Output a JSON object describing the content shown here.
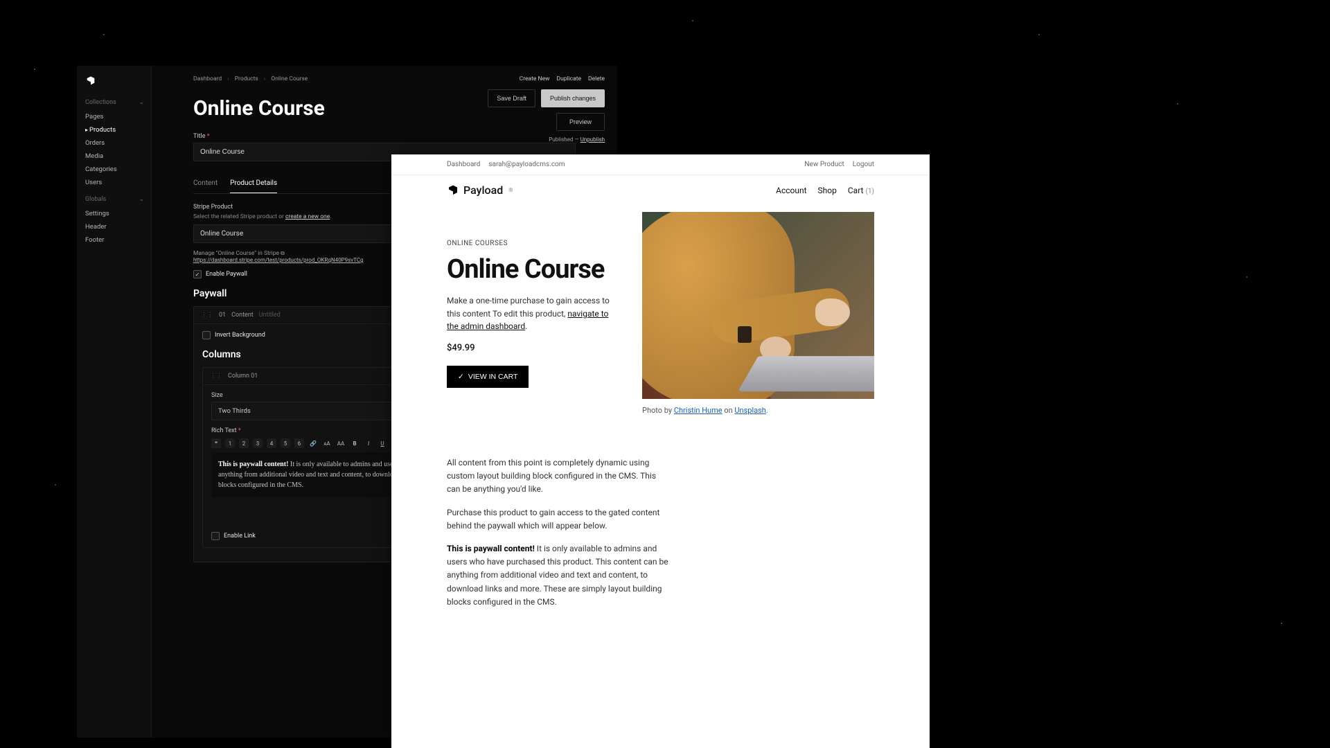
{
  "admin": {
    "breadcrumb": [
      "Dashboard",
      "Products",
      "Online Course"
    ],
    "page_title": "Online Course",
    "actions": {
      "create_new": "Create New",
      "duplicate": "Duplicate",
      "delete": "Delete",
      "save_draft": "Save Draft",
      "publish": "Publish changes",
      "preview": "Preview",
      "published_label": "Published",
      "unpublish": "Unpublish"
    },
    "sidebar": {
      "collections_label": "Collections",
      "collections": [
        "Pages",
        "Products",
        "Orders",
        "Media",
        "Categories",
        "Users"
      ],
      "active_collection": "Products",
      "globals_label": "Globals",
      "globals": [
        "Settings",
        "Header",
        "Footer"
      ]
    },
    "fields": {
      "title_label": "Title",
      "title_value": "Online Course",
      "tabs": [
        "Content",
        "Product Details"
      ],
      "active_tab": "Product Details",
      "stripe_label": "Stripe Product",
      "stripe_help_pre": "Select the related Stripe product or ",
      "stripe_help_link": "create a new one",
      "stripe_value": "Online Course",
      "manage_line": "Manage \"Online Course\" in Stripe",
      "stripe_url": "https://dashboard.stripe.com/test/products/prod_OKRqN40P9svTCg",
      "enable_paywall": "Enable Paywall",
      "paywall_heading": "Paywall",
      "block": {
        "num": "01",
        "label": "Content",
        "untitled": "Untitled",
        "invert_bg": "Invert Background",
        "columns_heading": "Columns",
        "column": {
          "name": "Column 01",
          "size_label": "Size",
          "size_value": "Two Thirds",
          "richtext_label": "Rich Text",
          "rte_bold": "This is paywall content!",
          "rte_rest": " It is only available to admins and users who have purchased this product. This content can be anything from additional video and text and content, to download links and more. These are simply layout building blocks configured in the CMS.",
          "enable_link": "Enable Link"
        }
      }
    }
  },
  "front": {
    "topbar": {
      "dashboard": "Dashboard",
      "email": "sarah@payloadcms.com",
      "new_product": "New Product",
      "logout": "Logout"
    },
    "brand": "Payload",
    "nav": {
      "account": "Account",
      "shop": "Shop",
      "cart": "Cart",
      "cart_count": "(1)"
    },
    "eyebrow": "ONLINE COURSES",
    "title": "Online Course",
    "lede_pre": "Make a one-time purchase to gain access to this content To edit this product, ",
    "lede_link": "navigate to the admin dashboard",
    "price": "$49.99",
    "cart_button": "VIEW IN CART",
    "credit_pre": "Photo by ",
    "credit_author": "Christin Hume",
    "credit_mid": " on ",
    "credit_src": "Unsplash",
    "body1": "All content from this point is completely dynamic using custom layout building block configured in the CMS. This can be anything you'd like.",
    "body2": "Purchase this product to gain access to the gated content behind the paywall which will appear below.",
    "body3_bold": "This is paywall content!",
    "body3_rest": " It is only available to admins and users who have purchased this product. This content can be anything from additional video and text and content, to download links and more. These are simply layout building blocks configured in the CMS."
  }
}
